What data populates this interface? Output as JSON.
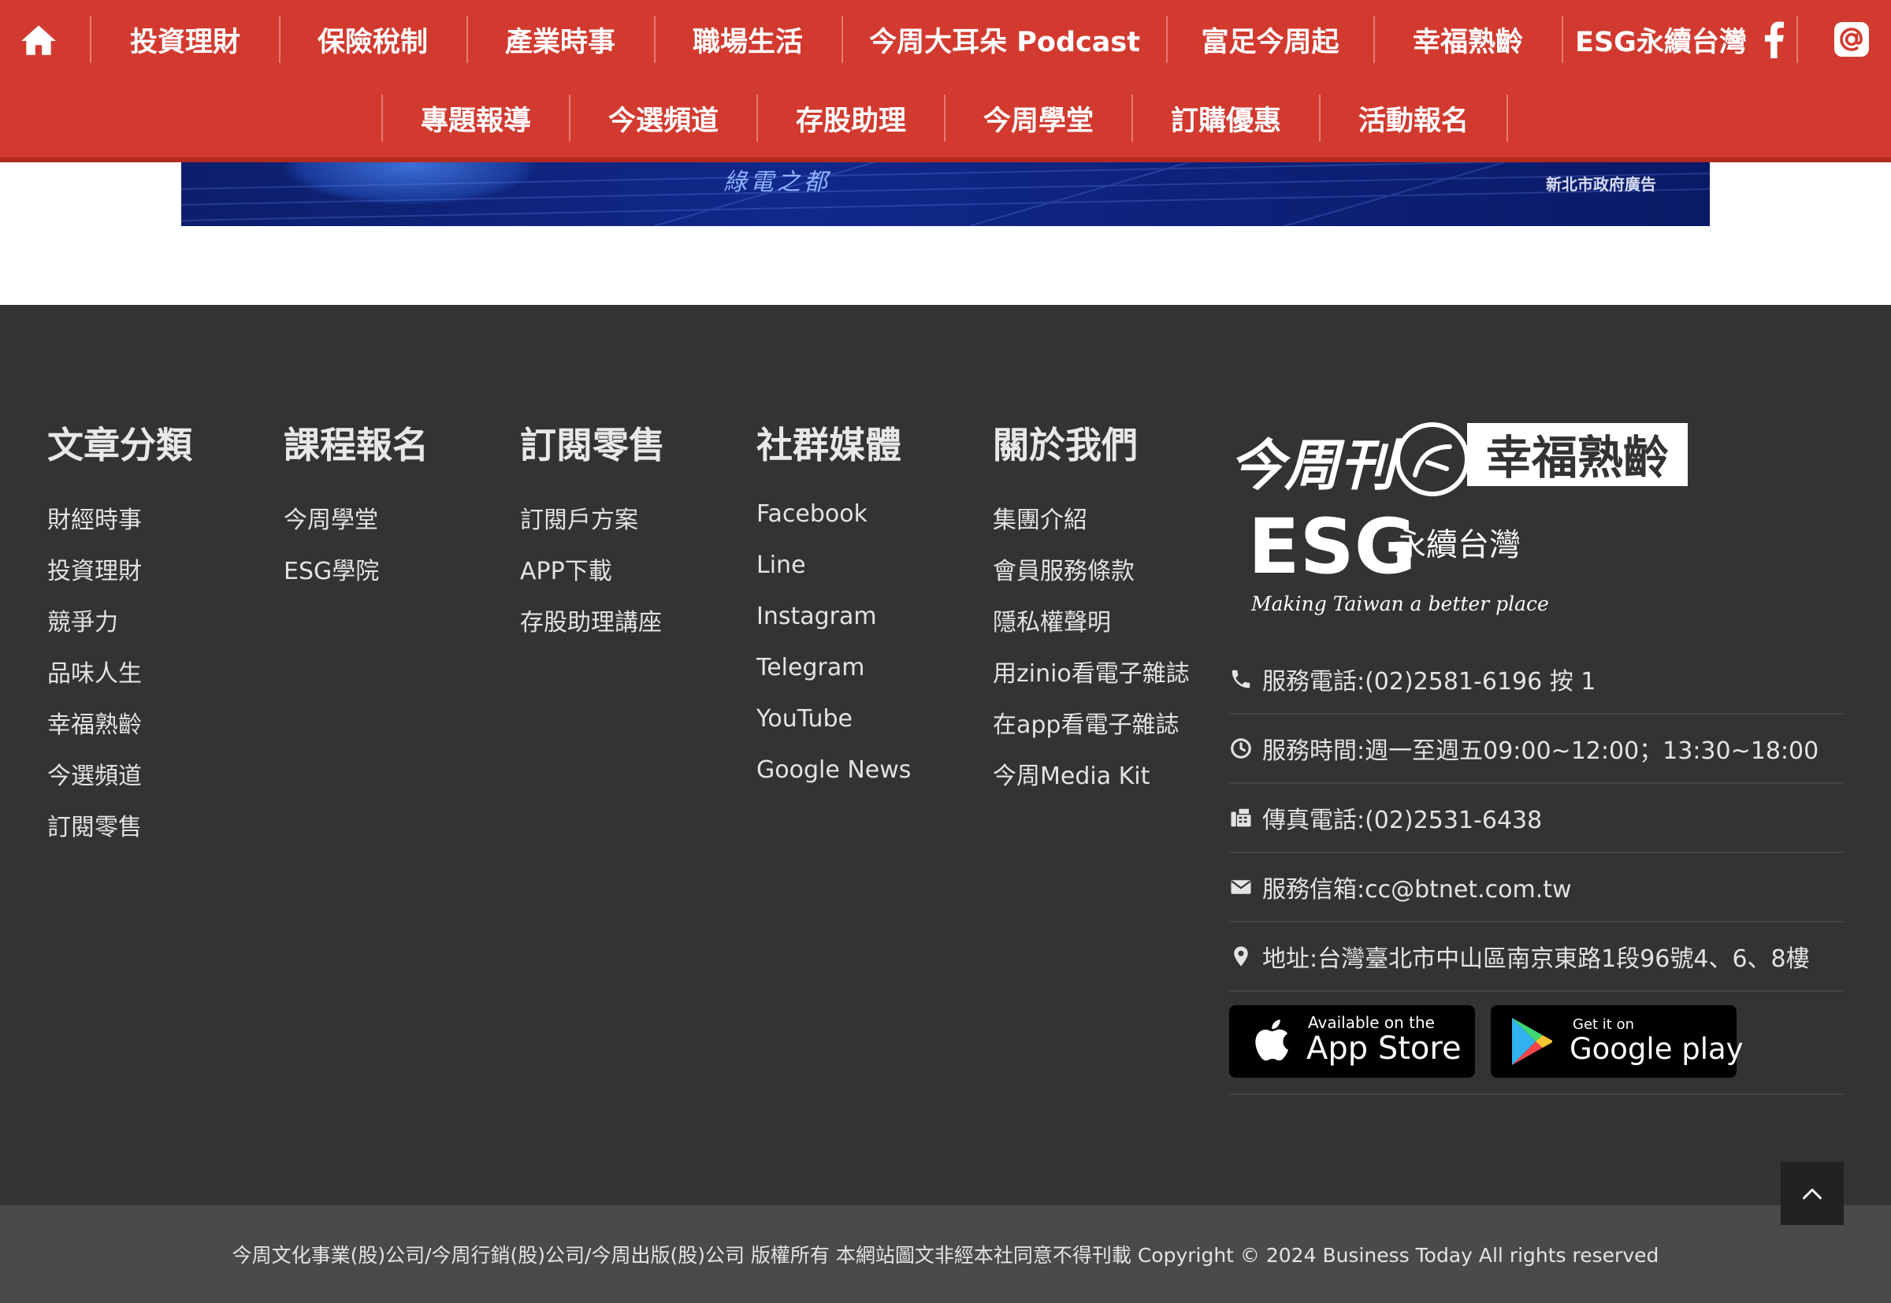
{
  "nav": {
    "row1": [
      "投資理財",
      "保險稅制",
      "產業時事",
      "職場生活",
      "今周大耳朵 Podcast",
      "富足今周起",
      "幸福熟齡",
      "ESG永續台灣"
    ],
    "row2": [
      "專題報導",
      "今選頻道",
      "存股助理",
      "今周學堂",
      "訂購優惠",
      "活動報名"
    ]
  },
  "banner": {
    "slogan": "綠電之都",
    "ad_label": "新北市政府廣告"
  },
  "footer": {
    "columns": [
      {
        "title": "文章分類",
        "links": [
          "財經時事",
          "投資理財",
          "競爭力",
          "品味人生",
          "幸福熟齡",
          "今選頻道",
          "訂閱零售"
        ]
      },
      {
        "title": "課程報名",
        "links": [
          "今周學堂",
          "ESG學院"
        ]
      },
      {
        "title": "訂閱零售",
        "links": [
          "訂閱戶方案",
          "APP下載",
          "存股助理講座"
        ]
      },
      {
        "title": "社群媒體",
        "links": [
          "Facebook",
          "Line",
          "Instagram",
          "Telegram",
          "YouTube",
          "Google News"
        ]
      },
      {
        "title": "關於我們",
        "links": [
          "集團介紹",
          "會員服務條款",
          "隱私權聲明",
          "用zinio看電子雜誌",
          "在app看電子雜誌",
          "今周Media Kit"
        ]
      }
    ],
    "brands": {
      "logo1": "今周刊",
      "logo2": "幸福熟齡",
      "esg": "ESG",
      "esg_sub": "永續台灣",
      "esg_tagline": "Making Taiwan a better place"
    },
    "contact": {
      "phone": "服務電話:(02)2581-6196 按 1",
      "hours": "服務時間:週一至週五09:00~12:00；13:30~18:00",
      "fax": "傳真電話:(02)2531-6438",
      "email": "服務信箱:cc@btnet.com.tw",
      "address": "地址:台灣臺北市中山區南京東路1段96號4、6、8樓"
    },
    "apps": {
      "appstore_small": "Available on the",
      "appstore_big": "App Store",
      "googleplay_small": "Get it on",
      "googleplay_big": "Google play"
    },
    "copyright": "今周文化事業(股)公司/今周行銷(股)公司/今周出版(股)公司 版權所有 本網站圖文非經本社同意不得刊載 Copyright © 2024 Business Today All rights reserved"
  },
  "colors": {
    "nav_red": "#d23a2f",
    "footer_bg": "#333333",
    "bottom_bar": "#4a4a4a"
  },
  "icons": [
    "home-icon",
    "facebook-icon",
    "at-sign-icon",
    "phone-icon",
    "clock-icon",
    "fax-icon",
    "mail-icon",
    "map-pin-icon",
    "apple-icon",
    "google-play-icon",
    "chevron-up-icon"
  ]
}
